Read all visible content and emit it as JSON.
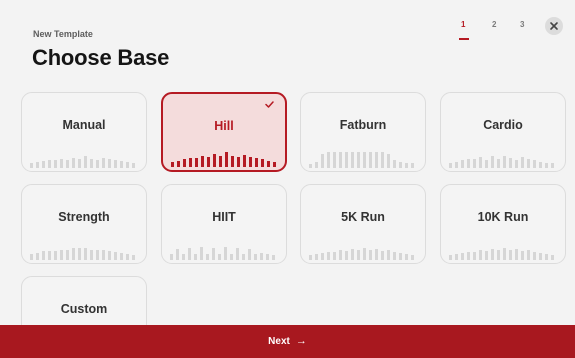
{
  "header": {
    "subtitle": "New Template",
    "title": "Choose Base",
    "steps": [
      "1",
      "2",
      "3"
    ],
    "active_step": "1",
    "close_icon": "close-icon"
  },
  "colors": {
    "accent": "#b51a23",
    "footer": "#a8181f",
    "card_bg": "#f4f4f4",
    "selected_bg": "#f4dcdc"
  },
  "templates": [
    {
      "label": "Manual",
      "selected": false
    },
    {
      "label": "Hill",
      "selected": true,
      "check_icon": "checkmark-icon"
    },
    {
      "label": "Fatburn",
      "selected": false
    },
    {
      "label": "Cardio",
      "selected": false
    },
    {
      "label": "Strength",
      "selected": false
    },
    {
      "label": "HIIT",
      "selected": false
    },
    {
      "label": "5K Run",
      "selected": false
    },
    {
      "label": "10K Run",
      "selected": false
    },
    {
      "label": "Custom",
      "selected": false
    }
  ],
  "footer": {
    "next_label": "Next",
    "arrow_icon": "arrow-right-icon"
  }
}
